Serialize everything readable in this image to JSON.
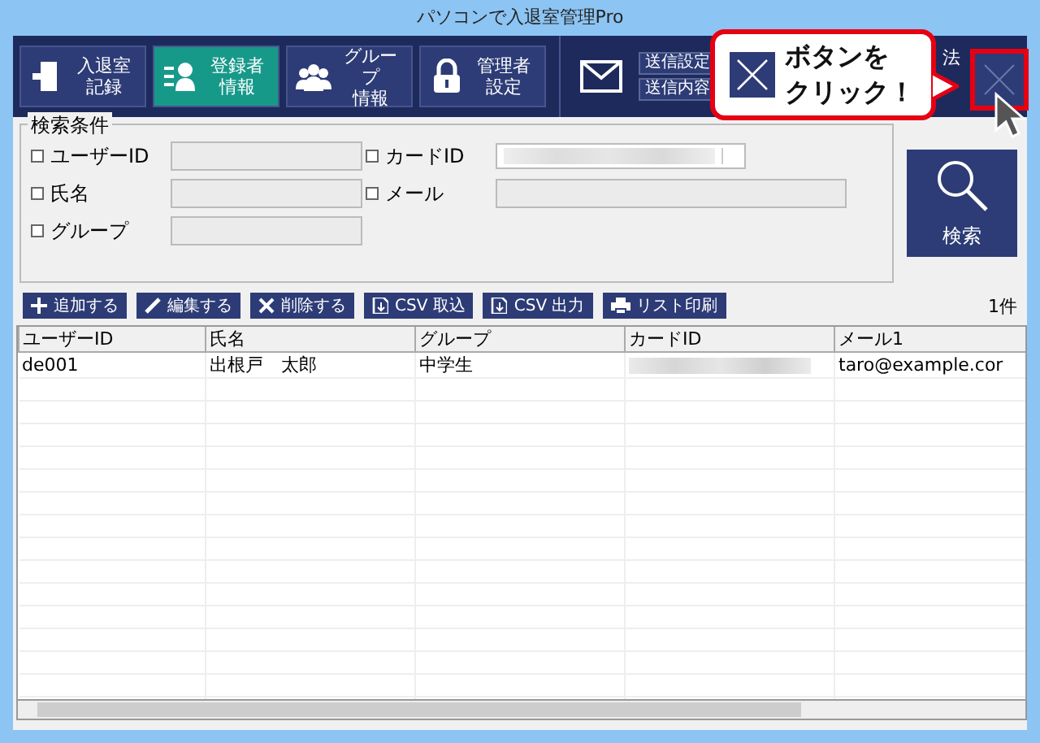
{
  "window": {
    "title": "パソコンで入退室管理Pro"
  },
  "toolbar": {
    "nav": [
      {
        "kind": "door",
        "lines": [
          "入退室",
          "記録"
        ],
        "selected": false
      },
      {
        "kind": "person",
        "lines": [
          "登録者",
          "情報"
        ],
        "selected": true
      },
      {
        "kind": "group",
        "lines": [
          "グループ",
          "情報"
        ],
        "selected": false
      },
      {
        "kind": "lock",
        "lines": [
          "管理者",
          "設定"
        ],
        "selected": false
      }
    ],
    "mail_buttons": [
      "送信設定",
      "送信内容"
    ],
    "fragment": "法"
  },
  "callout": {
    "lines": [
      "ボタンを",
      "クリック！"
    ]
  },
  "search": {
    "title": "検索条件",
    "fields": [
      {
        "label": "ユーザーID",
        "checked": false,
        "kind": "text"
      },
      {
        "label": "カードID",
        "checked": false,
        "kind": "combo"
      },
      {
        "label": "氏名",
        "checked": false,
        "kind": "text"
      },
      {
        "label": "メール",
        "checked": false,
        "kind": "wide"
      },
      {
        "label": "グループ",
        "checked": false,
        "kind": "text"
      }
    ],
    "button": "検索"
  },
  "actions": [
    {
      "kind": "plus",
      "label": "追加する"
    },
    {
      "kind": "pen",
      "label": "編集する"
    },
    {
      "kind": "cross",
      "label": "削除する"
    },
    {
      "kind": "doc",
      "label": "CSV 取込"
    },
    {
      "kind": "doc",
      "label": "CSV 出力"
    },
    {
      "kind": "printer",
      "label": "リスト印刷"
    }
  ],
  "count": "1件",
  "table": {
    "columns": [
      "ユーザーID",
      "氏名",
      "グループ",
      "カードID",
      "メール1"
    ],
    "rows": [
      [
        "de001",
        "出根戸　太郎",
        "中学生",
        null,
        "taro@example.cor"
      ]
    ]
  }
}
